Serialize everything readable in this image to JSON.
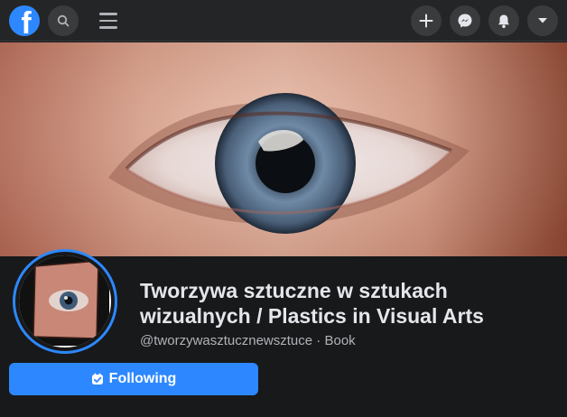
{
  "topbar": {
    "logo": "facebook-logo",
    "logo_letter": "f",
    "icons": [
      "search-icon",
      "menu-icon",
      "plus-icon",
      "messenger-icon",
      "notifications-icon",
      "chevron-down-icon"
    ]
  },
  "page": {
    "title": "Tworzywa sztuczne w sztukach wizualnych / Plastics in Visual Arts",
    "handle": "@tworzywasztucznewsztuce",
    "separator": " · ",
    "category": "Book"
  },
  "actions": {
    "following_label": "Following"
  },
  "colors": {
    "accent": "#2d88ff",
    "background": "#18191a",
    "topbar": "#242526"
  }
}
